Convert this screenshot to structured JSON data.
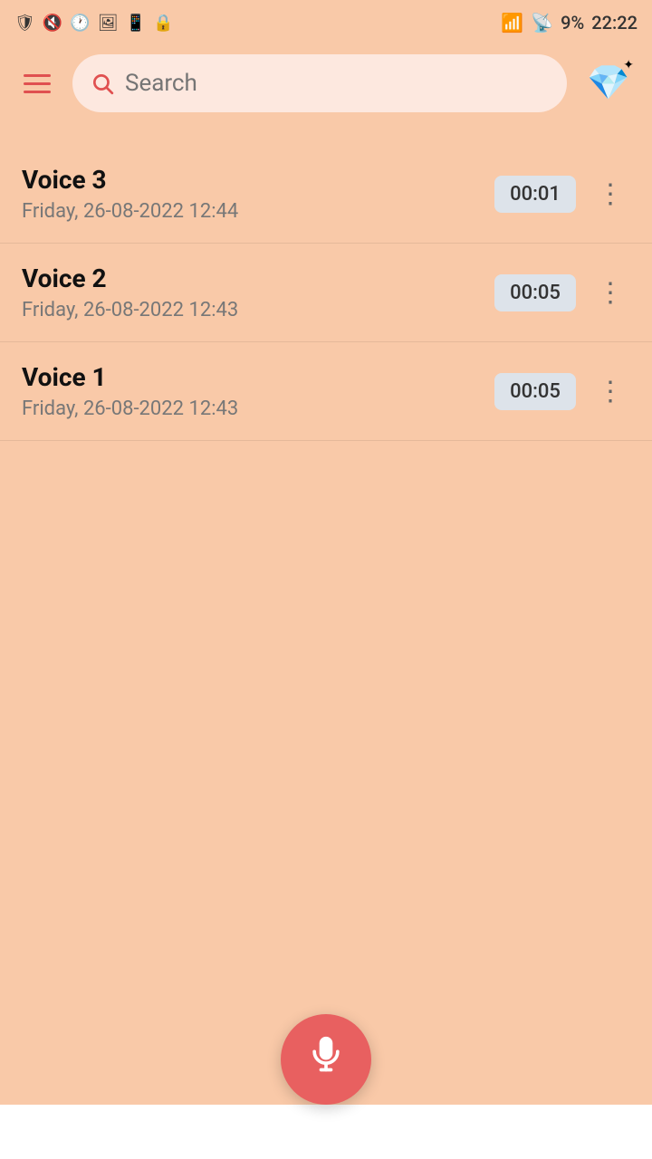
{
  "statusBar": {
    "time": "22:22",
    "battery": "9%",
    "leftIcons": [
      "shield",
      "no-disturb",
      "clock",
      "image",
      "screen",
      "lock"
    ],
    "rightIcons": [
      "wifi",
      "signal",
      "battery"
    ]
  },
  "topBar": {
    "menuLabel": "Menu",
    "search": {
      "placeholder": "Search"
    },
    "premiumIcon": "💎"
  },
  "voiceList": {
    "items": [
      {
        "id": "voice3",
        "name": "Voice 3",
        "date": "Friday, 26-08-2022 12:44",
        "duration": "00:01"
      },
      {
        "id": "voice2",
        "name": "Voice 2",
        "date": "Friday, 26-08-2022 12:43",
        "duration": "00:05"
      },
      {
        "id": "voice1",
        "name": "Voice 1",
        "date": "Friday, 26-08-2022 12:43",
        "duration": "00:05"
      }
    ]
  },
  "recordButton": {
    "label": "Record"
  }
}
